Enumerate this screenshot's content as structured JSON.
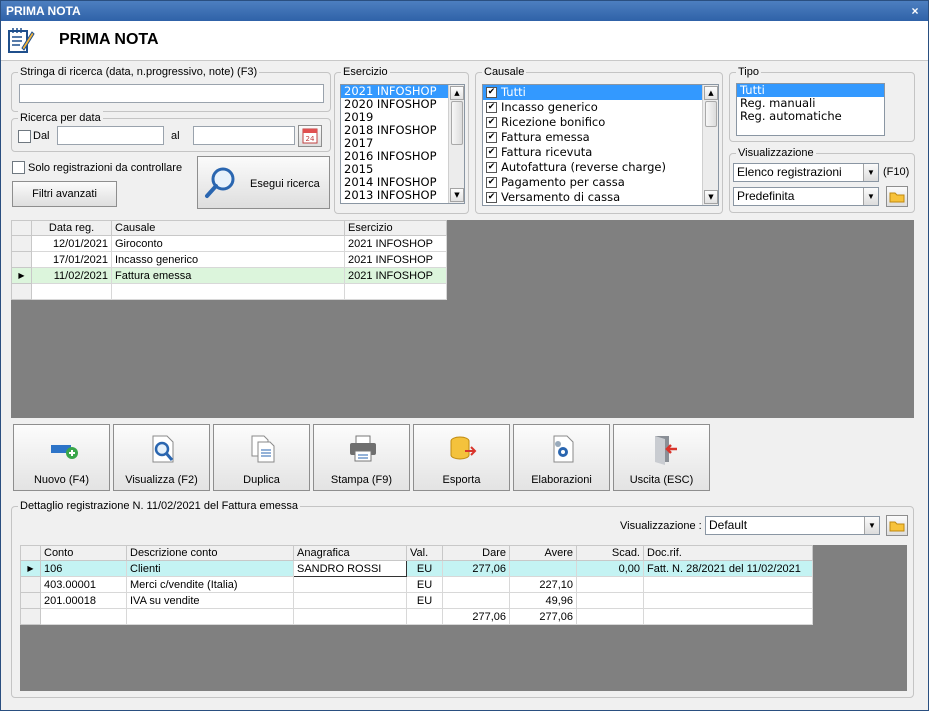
{
  "window": {
    "title": "PRIMA NOTA",
    "close_glyph": "×",
    "header_title": "PRIMA NOTA",
    "header_icon": "notepad-pencil-icon"
  },
  "search": {
    "group_label": "Stringa di ricerca (data, n.progressivo, note) (F3)",
    "value": "",
    "date_group_label": "Ricerca per data",
    "dal_label": "Dal",
    "dal_checked": false,
    "dal_value": "",
    "al_label": "al",
    "al_value": "",
    "calendar_day": "24",
    "solo_label": "Solo registrazioni da controllare",
    "solo_checked": false,
    "filtri_label": "Filtri avanzati",
    "esegui_label": "Esegui ricerca"
  },
  "esercizio": {
    "label": "Esercizio",
    "items": [
      "2021 INFOSHOP",
      "2020 INFOSHOP",
      "2019",
      "2018 INFOSHOP",
      "2017",
      "2016 INFOSHOP",
      "2015",
      "2014 INFOSHOP",
      "2013 INFOSHOP"
    ],
    "selected": 0
  },
  "causale": {
    "label": "Causale",
    "items": [
      {
        "label": "Tutti",
        "checked": true
      },
      {
        "label": "Incasso generico",
        "checked": true
      },
      {
        "label": "Ricezione bonifico",
        "checked": true
      },
      {
        "label": "Fattura emessa",
        "checked": true
      },
      {
        "label": "Fattura ricevuta",
        "checked": true
      },
      {
        "label": "Autofattura (reverse charge)",
        "checked": true
      },
      {
        "label": "Pagamento per cassa",
        "checked": true
      },
      {
        "label": "Versamento di cassa",
        "checked": true
      }
    ],
    "selected": 0
  },
  "tipo": {
    "label": "Tipo",
    "items": [
      "Tutti",
      "Reg. manuali",
      "Reg. automatiche"
    ],
    "selected": 0
  },
  "visualizzazione_top": {
    "label": "Visualizzazione",
    "combo1": "Elenco registrazioni",
    "shortcut": "(F10)",
    "combo2": "Predefinita"
  },
  "registrations": {
    "columns": [
      "Data reg.",
      "Causale",
      "Esercizio"
    ],
    "rows": [
      {
        "data": "12/01/2021",
        "causale": "Giroconto",
        "esercizio": "2021 INFOSHOP"
      },
      {
        "data": "17/01/2021",
        "causale": "Incasso generico",
        "esercizio": "2021 INFOSHOP"
      },
      {
        "data": "11/02/2021",
        "causale": "Fattura emessa",
        "esercizio": "2021 INFOSHOP"
      }
    ],
    "selected_row": 2
  },
  "toolbar": [
    {
      "name": "nuovo-button",
      "label": "Nuovo (F4)",
      "icon": "new-record-icon"
    },
    {
      "name": "visualizza-button",
      "label": "Visualizza (F2)",
      "icon": "document-magnifier-icon"
    },
    {
      "name": "duplica-button",
      "label": "Duplica",
      "icon": "duplicate-documents-icon"
    },
    {
      "name": "stampa-button",
      "label": "Stampa (F9)",
      "icon": "printer-icon"
    },
    {
      "name": "esporta-button",
      "label": "Esporta",
      "icon": "export-database-icon"
    },
    {
      "name": "elaborazioni-button",
      "label": "Elaborazioni",
      "icon": "document-gear-icon"
    },
    {
      "name": "uscita-button",
      "label": "Uscita (ESC)",
      "icon": "exit-door-icon"
    }
  ],
  "detail": {
    "group_label": "Dettaglio registrazione N. 11/02/2021 del Fattura emessa",
    "visualizzazione_label": "Visualizzazione :",
    "visualizzazione_value": "Default",
    "columns": [
      "Conto",
      "Descrizione conto",
      "Anagrafica",
      "Val.",
      "Dare",
      "Avere",
      "Scad.",
      "Doc.rif."
    ],
    "rows": [
      {
        "conto": "106",
        "descrizione": "Clienti",
        "anagrafica": "SANDRO ROSSI",
        "val": "EU",
        "dare": "277,06",
        "avere": "",
        "scad": "0,00",
        "docrif": "Fatt. N. 28/2021 del 11/02/2021"
      },
      {
        "conto": "403.00001",
        "descrizione": "Merci c/vendite (Italia)",
        "anagrafica": "",
        "val": "EU",
        "dare": "",
        "avere": "227,10",
        "scad": "",
        "docrif": ""
      },
      {
        "conto": "201.00018",
        "descrizione": "IVA su vendite",
        "anagrafica": "",
        "val": "EU",
        "dare": "",
        "avere": "49,96",
        "scad": "",
        "docrif": ""
      }
    ],
    "totals": {
      "dare": "277,06",
      "avere": "277,06"
    },
    "selected_row": 0
  }
}
